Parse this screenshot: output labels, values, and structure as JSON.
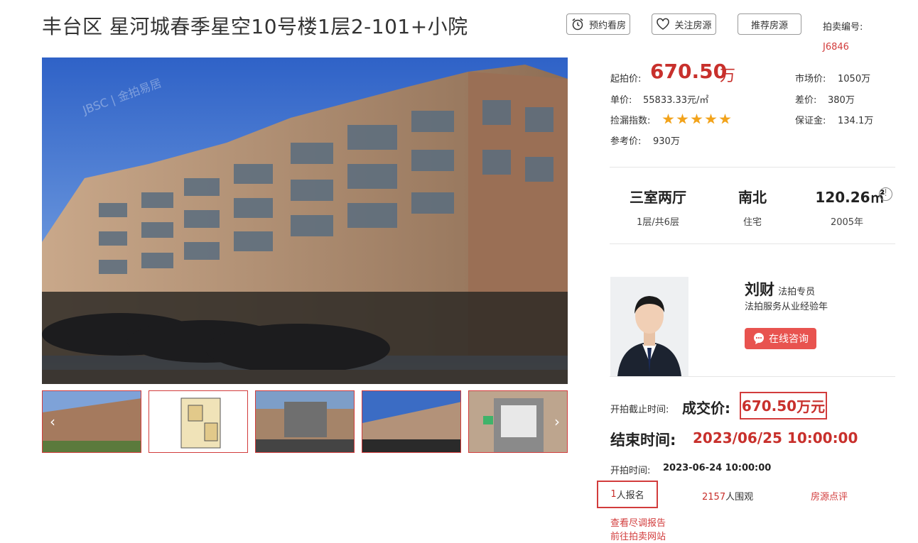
{
  "header": {
    "title": "丰台区 星河城春季星空10号楼1层2-101+小院",
    "btn_visit": "预约看房",
    "btn_follow": "关注房源",
    "btn_recommend": "推荐房源",
    "lot_label": "拍卖编号:",
    "lot_no": "J6846"
  },
  "gallery": {
    "watermark": "JBSC | 金拍易居",
    "prev_glyph": "‹",
    "next_glyph": "›",
    "thumbs": [
      "exterior",
      "floorplan",
      "gate",
      "buildings",
      "entrance"
    ]
  },
  "price": {
    "start_label": "起拍价:",
    "start_value": "670.50",
    "start_unit": "万",
    "market_label": "市场价:",
    "market_value": "1050万",
    "unit_label": "单价:",
    "unit_value": "55833.33元/㎡",
    "diff_label": "差价:",
    "diff_value": "380万",
    "index_label": "捡漏指数:",
    "index_stars": 5,
    "deposit_label": "保证金:",
    "deposit_value": "134.1万",
    "ref_label": "参考价:",
    "ref_value": "930万"
  },
  "specs": [
    {
      "value": "三室两厅",
      "sub": "1层/共6层"
    },
    {
      "value": "南北",
      "sub": "住宅"
    },
    {
      "value": "120.26㎡",
      "sub": "2005年"
    }
  ],
  "agent": {
    "name": "刘财",
    "role": "法拍专员",
    "desc": "法拍服务从业经验年",
    "consult": "在线咨询"
  },
  "auction": {
    "deadline_label": "开拍截止时间:",
    "deal_label": "成交价:",
    "deal_value": "670.50",
    "deal_unit": "万元",
    "end_label": "结束时间:",
    "end_value": "2023/06/25 10:00:00",
    "start_label": "开拍时间:",
    "start_value": "2023-06-24 10:00:00",
    "signup_count": "1",
    "signup_label": "人报名",
    "viewers_count": "2157",
    "viewers_label": "人围观",
    "review": "房源点评",
    "report_link": "查看尽调报告",
    "site_link": "前往拍卖网站"
  },
  "colors": {
    "accent": "#c8302c",
    "star": "#f2a31b",
    "consult_bg": "#e8534f"
  }
}
